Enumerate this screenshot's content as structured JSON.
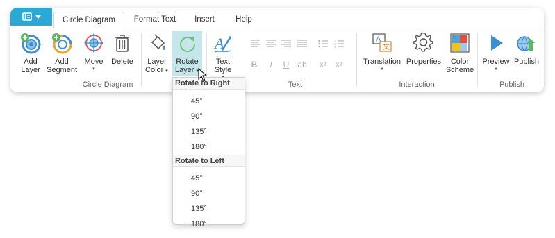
{
  "tabs": [
    {
      "label": "Circle Diagram",
      "active": true
    },
    {
      "label": "Format Text"
    },
    {
      "label": "Insert"
    },
    {
      "label": "Help"
    }
  ],
  "ribbon": {
    "add_layer": "Add\nLayer",
    "add_segment": "Add\nSegment",
    "move": "Move",
    "delete": "Delete",
    "layer_color": "Layer\nColor",
    "rotate_layer": "Rotate\nLayer",
    "text_style": "Text\nStyle",
    "translation": "Translation",
    "properties": "Properties",
    "color_scheme": "Color\nScheme",
    "preview": "Preview",
    "publish": "Publish",
    "groups": {
      "circle_diagram": "Circle Diagram",
      "text": "Text",
      "interaction": "Interaction",
      "publish": "Publish"
    },
    "text_tools": [
      "B",
      "I",
      "U",
      "ab",
      "x2",
      "x2"
    ]
  },
  "menu": {
    "right_header": "Rotate to Right",
    "right_items": [
      "45°",
      "90°",
      "135°",
      "180°"
    ],
    "left_header": "Rotate to Left",
    "left_items": [
      "45°",
      "90°",
      "135°",
      "180°"
    ]
  },
  "colors": {
    "accent": "#2aa8d6",
    "highlight": "#c5e6ea",
    "green": "#5cb85c",
    "blue": "#3e8ed0"
  }
}
